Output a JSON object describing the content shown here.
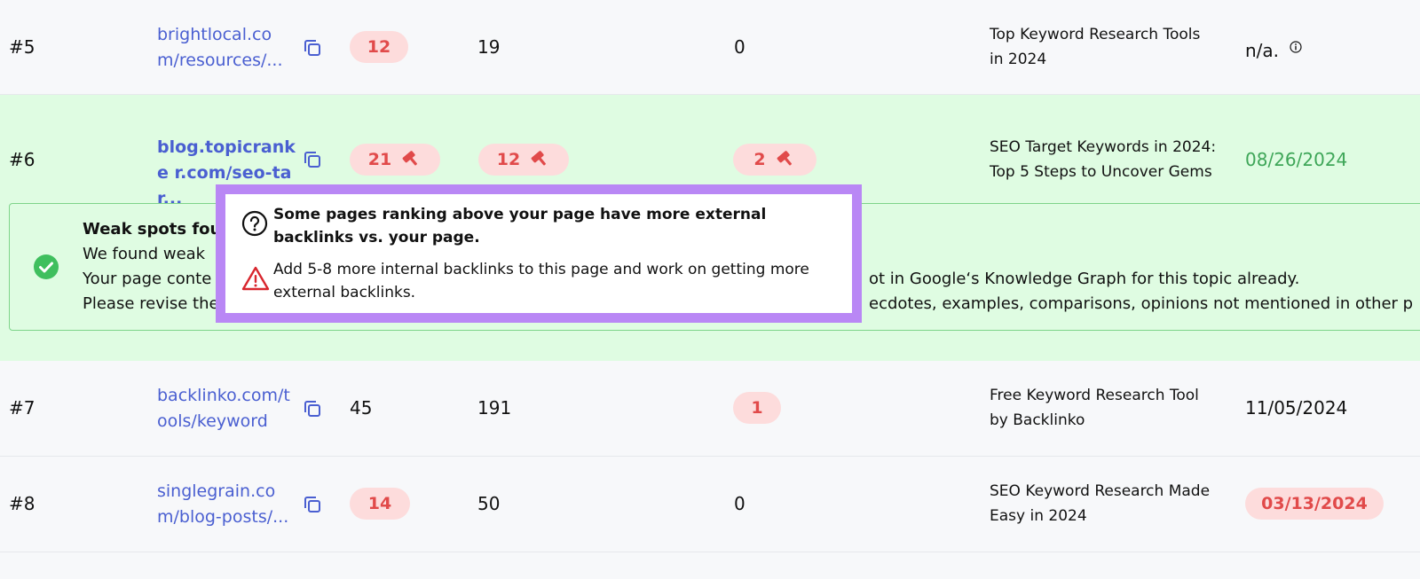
{
  "rows": [
    {
      "rank": "#5",
      "url": "brightlocal.co m/resources/...",
      "col1": "12",
      "col2": "19",
      "col3": "0",
      "title_line1": "Top Keyword Research Tools",
      "title_line2": "in 2024",
      "date": "n/a."
    },
    {
      "rank": "#6",
      "url": "blog.topicranke r.com/seo-tar...",
      "col1": "21",
      "col2": "12",
      "col3": "2",
      "title_line1": "SEO Target Keywords in 2024:",
      "title_line2": "Top 5 Steps to Uncover Gems",
      "date": "08/26/2024"
    },
    {
      "rank": "#7",
      "url": "backlinko.com/t ools/keyword",
      "col1": "45",
      "col2": "191",
      "col3": "1",
      "title_line1": "Free Keyword Research Tool",
      "title_line2": "by Backlinko",
      "date": "11/05/2024"
    },
    {
      "rank": "#8",
      "url": "singlegrain.co m/blog-posts/...",
      "col1": "14",
      "col2": "50",
      "col3": "0",
      "title_line1": "SEO Keyword Research Made",
      "title_line2": "Easy in 2024",
      "date": "03/13/2024"
    }
  ],
  "weak_spots": {
    "title": "Weak spots fou",
    "line1": "We found weak",
    "line2_start": "Your page conte",
    "line2_end": "ot in Google‘s Knowledge Graph for this topic already.",
    "line3_start": "Please revise the",
    "line3_end": "ecdotes, examples, comparisons, opinions not mentioned in other p"
  },
  "popover": {
    "question": "Some pages ranking above your page have more external backlinks vs. your page.",
    "advice": "Add 5-8 more internal backlinks to this page and work on getting more external backlinks."
  },
  "colors": {
    "link": "#4a5fd1",
    "pill_bg": "#fddcdc",
    "pill_text": "#e14a4a",
    "highlight_row": "#dffce2",
    "good_date": "#3ea658",
    "popover_border": "#b987f5"
  },
  "icons": [
    "copy-icon",
    "hammer-icon",
    "info-icon",
    "check-circle-icon",
    "question-circle-icon",
    "warning-triangle-icon"
  ]
}
